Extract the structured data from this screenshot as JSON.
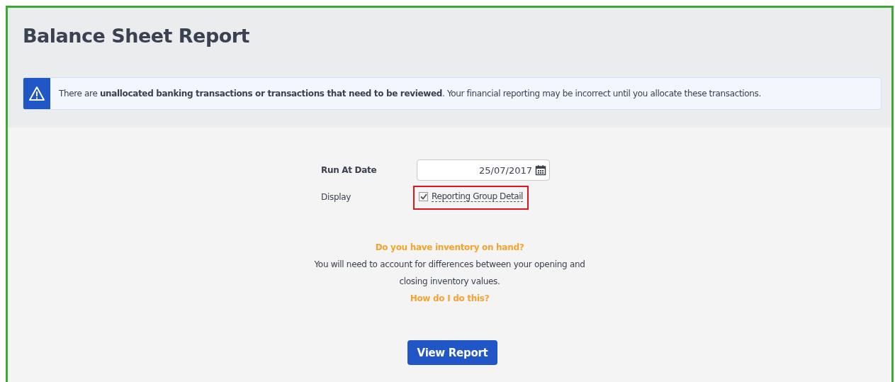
{
  "page": {
    "title": "Balance Sheet Report"
  },
  "alert": {
    "text": "There are **unallocated banking transactions or transactions that need to be reviewed**. Your financial reporting may be incorrect until you allocate these transactions."
  },
  "form": {
    "run_at_date": {
      "label": "Run At Date",
      "value": "25/07/2017"
    },
    "display": {
      "label": "Display",
      "option": {
        "label": "Reporting Group Detail",
        "checked": true,
        "highlighted": true
      }
    }
  },
  "inventory": {
    "question": "Do you have inventory on hand?",
    "text": "You will need to account for differences between your opening and closing inventory values.",
    "link": "How do I do this?"
  },
  "buttons": [
    {
      "label": "View Report"
    }
  ]
}
